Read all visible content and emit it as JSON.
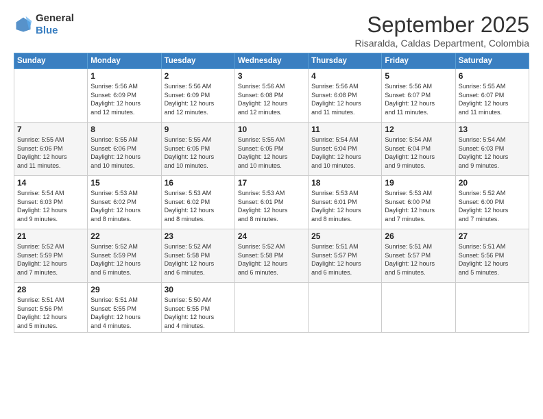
{
  "logo": {
    "general": "General",
    "blue": "Blue"
  },
  "header": {
    "month": "September 2025",
    "location": "Risaralda, Caldas Department, Colombia"
  },
  "days_of_week": [
    "Sunday",
    "Monday",
    "Tuesday",
    "Wednesday",
    "Thursday",
    "Friday",
    "Saturday"
  ],
  "weeks": [
    [
      {
        "day": "",
        "info": ""
      },
      {
        "day": "1",
        "info": "Sunrise: 5:56 AM\nSunset: 6:09 PM\nDaylight: 12 hours\nand 12 minutes."
      },
      {
        "day": "2",
        "info": "Sunrise: 5:56 AM\nSunset: 6:09 PM\nDaylight: 12 hours\nand 12 minutes."
      },
      {
        "day": "3",
        "info": "Sunrise: 5:56 AM\nSunset: 6:08 PM\nDaylight: 12 hours\nand 12 minutes."
      },
      {
        "day": "4",
        "info": "Sunrise: 5:56 AM\nSunset: 6:08 PM\nDaylight: 12 hours\nand 11 minutes."
      },
      {
        "day": "5",
        "info": "Sunrise: 5:56 AM\nSunset: 6:07 PM\nDaylight: 12 hours\nand 11 minutes."
      },
      {
        "day": "6",
        "info": "Sunrise: 5:55 AM\nSunset: 6:07 PM\nDaylight: 12 hours\nand 11 minutes."
      }
    ],
    [
      {
        "day": "7",
        "info": "Sunrise: 5:55 AM\nSunset: 6:06 PM\nDaylight: 12 hours\nand 11 minutes."
      },
      {
        "day": "8",
        "info": "Sunrise: 5:55 AM\nSunset: 6:06 PM\nDaylight: 12 hours\nand 10 minutes."
      },
      {
        "day": "9",
        "info": "Sunrise: 5:55 AM\nSunset: 6:05 PM\nDaylight: 12 hours\nand 10 minutes."
      },
      {
        "day": "10",
        "info": "Sunrise: 5:55 AM\nSunset: 6:05 PM\nDaylight: 12 hours\nand 10 minutes."
      },
      {
        "day": "11",
        "info": "Sunrise: 5:54 AM\nSunset: 6:04 PM\nDaylight: 12 hours\nand 10 minutes."
      },
      {
        "day": "12",
        "info": "Sunrise: 5:54 AM\nSunset: 6:04 PM\nDaylight: 12 hours\nand 9 minutes."
      },
      {
        "day": "13",
        "info": "Sunrise: 5:54 AM\nSunset: 6:03 PM\nDaylight: 12 hours\nand 9 minutes."
      }
    ],
    [
      {
        "day": "14",
        "info": "Sunrise: 5:54 AM\nSunset: 6:03 PM\nDaylight: 12 hours\nand 9 minutes."
      },
      {
        "day": "15",
        "info": "Sunrise: 5:53 AM\nSunset: 6:02 PM\nDaylight: 12 hours\nand 8 minutes."
      },
      {
        "day": "16",
        "info": "Sunrise: 5:53 AM\nSunset: 6:02 PM\nDaylight: 12 hours\nand 8 minutes."
      },
      {
        "day": "17",
        "info": "Sunrise: 5:53 AM\nSunset: 6:01 PM\nDaylight: 12 hours\nand 8 minutes."
      },
      {
        "day": "18",
        "info": "Sunrise: 5:53 AM\nSunset: 6:01 PM\nDaylight: 12 hours\nand 8 minutes."
      },
      {
        "day": "19",
        "info": "Sunrise: 5:53 AM\nSunset: 6:00 PM\nDaylight: 12 hours\nand 7 minutes."
      },
      {
        "day": "20",
        "info": "Sunrise: 5:52 AM\nSunset: 6:00 PM\nDaylight: 12 hours\nand 7 minutes."
      }
    ],
    [
      {
        "day": "21",
        "info": "Sunrise: 5:52 AM\nSunset: 5:59 PM\nDaylight: 12 hours\nand 7 minutes."
      },
      {
        "day": "22",
        "info": "Sunrise: 5:52 AM\nSunset: 5:59 PM\nDaylight: 12 hours\nand 6 minutes."
      },
      {
        "day": "23",
        "info": "Sunrise: 5:52 AM\nSunset: 5:58 PM\nDaylight: 12 hours\nand 6 minutes."
      },
      {
        "day": "24",
        "info": "Sunrise: 5:52 AM\nSunset: 5:58 PM\nDaylight: 12 hours\nand 6 minutes."
      },
      {
        "day": "25",
        "info": "Sunrise: 5:51 AM\nSunset: 5:57 PM\nDaylight: 12 hours\nand 6 minutes."
      },
      {
        "day": "26",
        "info": "Sunrise: 5:51 AM\nSunset: 5:57 PM\nDaylight: 12 hours\nand 5 minutes."
      },
      {
        "day": "27",
        "info": "Sunrise: 5:51 AM\nSunset: 5:56 PM\nDaylight: 12 hours\nand 5 minutes."
      }
    ],
    [
      {
        "day": "28",
        "info": "Sunrise: 5:51 AM\nSunset: 5:56 PM\nDaylight: 12 hours\nand 5 minutes."
      },
      {
        "day": "29",
        "info": "Sunrise: 5:51 AM\nSunset: 5:55 PM\nDaylight: 12 hours\nand 4 minutes."
      },
      {
        "day": "30",
        "info": "Sunrise: 5:50 AM\nSunset: 5:55 PM\nDaylight: 12 hours\nand 4 minutes."
      },
      {
        "day": "",
        "info": ""
      },
      {
        "day": "",
        "info": ""
      },
      {
        "day": "",
        "info": ""
      },
      {
        "day": "",
        "info": ""
      }
    ]
  ]
}
